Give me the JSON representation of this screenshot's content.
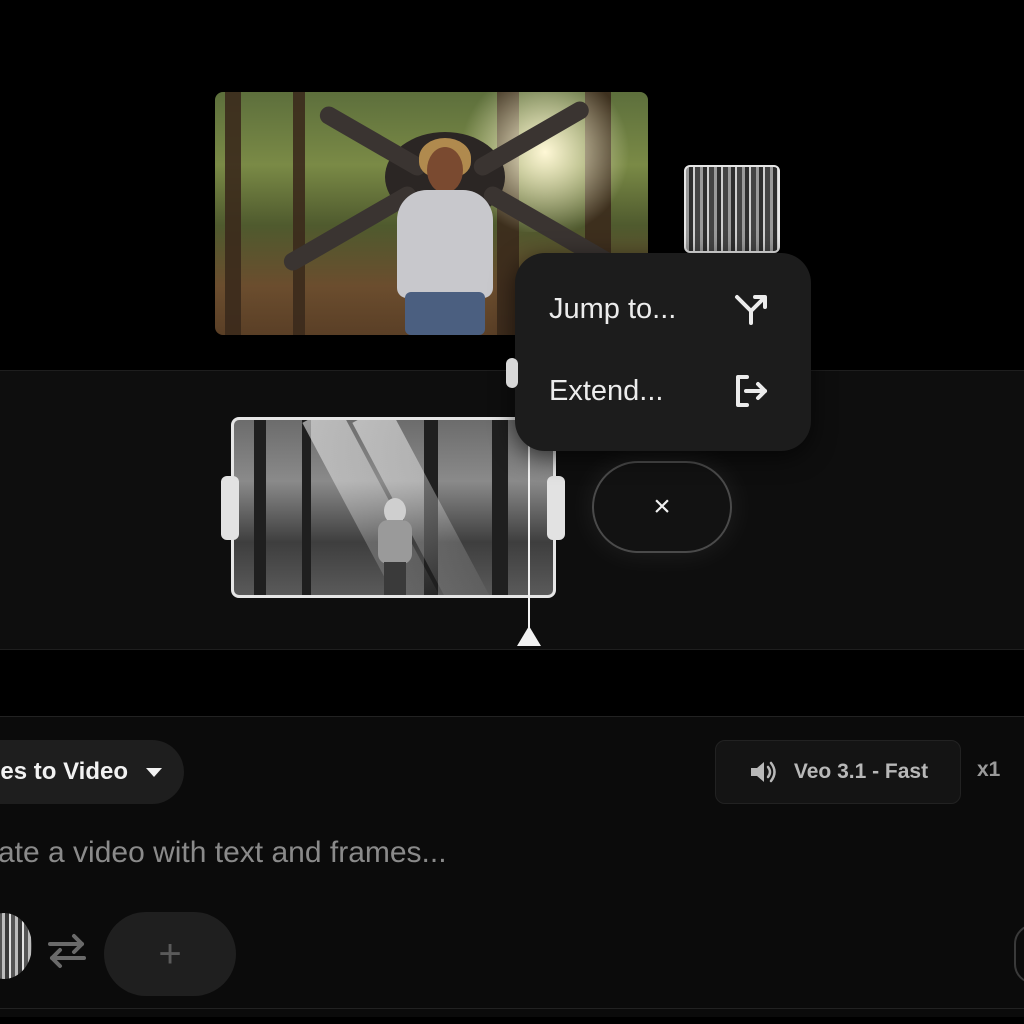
{
  "context_menu": {
    "items": [
      {
        "label": "Jump to...",
        "icon": "branch-arrow-icon"
      },
      {
        "label": "Extend...",
        "icon": "extend-exit-icon"
      }
    ]
  },
  "timeline": {
    "close_label": "×"
  },
  "composer": {
    "mode_label": "es to Video",
    "model_label": "Veo 3.1 - Fast",
    "model_icon": "speaker-icon",
    "output_count": "x1",
    "prompt_placeholder": "rate a video with text and frames...",
    "add_label": "+"
  },
  "colors": {
    "background": "#000000",
    "panel": "#0e0e0e",
    "menu": "#1c1c1c",
    "accent_white": "#e6e6e6"
  }
}
